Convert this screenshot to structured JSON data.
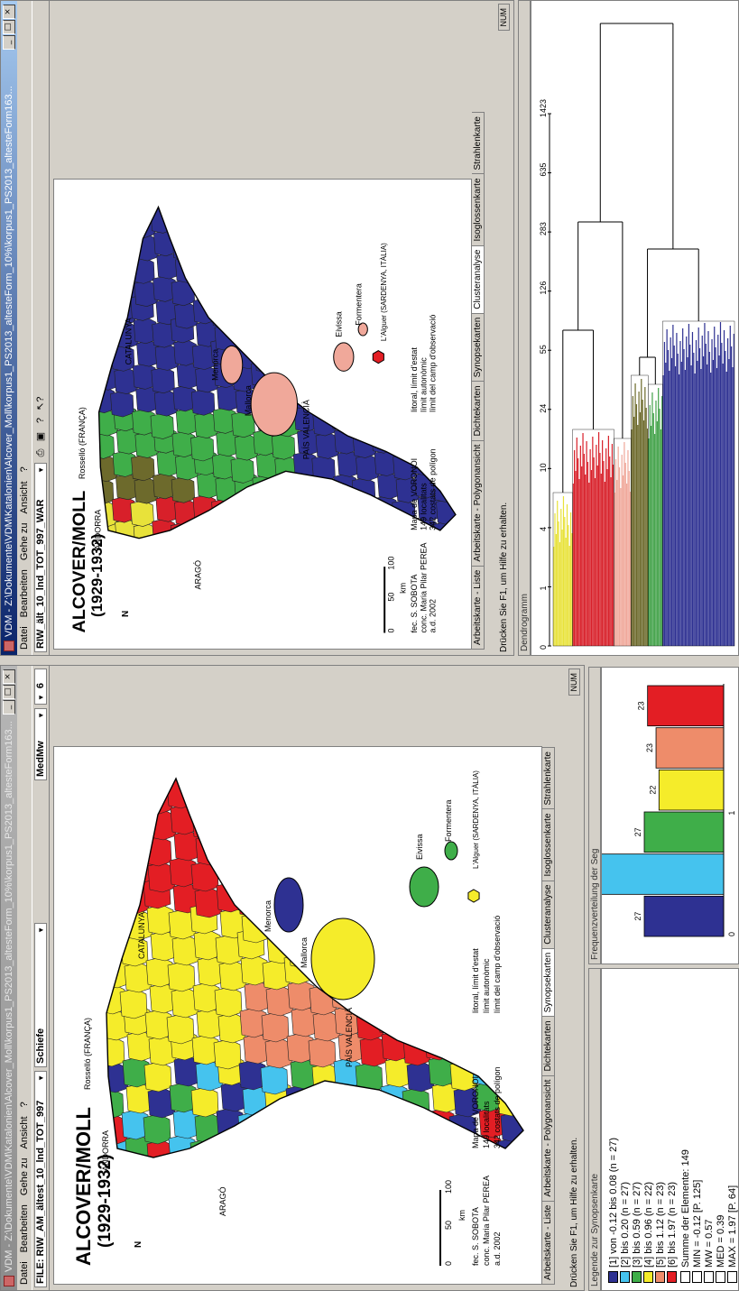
{
  "left_window": {
    "title": "VDM - Z:\\Dokumente\\VDM\\Katalonien\\Alcover_Moll\\korpus1_PS2013_altesteForm_10%\\korpus1_PS2013_altesteForm163...",
    "menu": [
      "Datei",
      "Bearbeiten",
      "Gehe zu",
      "Ansicht",
      "?"
    ],
    "file_label": "FILE: RIW_AM_ältest_10_lnd_TOT_997",
    "mode": "Schiefe",
    "algorithm": "MedMw",
    "classes": "6",
    "tabs": [
      "Arbeitskarte - Liste",
      "Arbeitskarte - Polygonansicht",
      "Dichtekarten",
      "Synopsekarten",
      "Clusteranalyse",
      "Isoglossenkarte",
      "Strahlenkarte"
    ],
    "status": "Drücken Sie F1, um Hilfe zu erhalten.",
    "num": "NUM"
  },
  "right_window": {
    "title": "VDM - Z:\\Dokumente\\VDM\\Katalonien\\Alcover_Moll\\korpus1_PS2013_altesteForm_10%\\korpus1_PS2013_altesteForm163...",
    "menu": [
      "Datei",
      "Bearbeiten",
      "Gehe zu",
      "Ansicht",
      "?"
    ],
    "file_label": "RIW_ält_10_lnd_TOT_997_WAR",
    "tabs": [
      "Arbeitskarte - Liste",
      "Arbeitskarte - Polygonansicht",
      "Dichtekarten",
      "Synopsekarten",
      "Clusteranalyse",
      "Isoglossenkarte",
      "Strahlenkarte"
    ],
    "status": "Drücken Sie F1, um Hilfe zu erhalten.",
    "num": "NUM"
  },
  "map": {
    "title_line1": "ALCOVER/MOLL",
    "title_line2": "(1929-1932)",
    "regions": [
      "ANDORRA",
      "Rosselló (FRANÇA)",
      "CATALUNYA",
      "ARAGÓ",
      "PAÍS VALENCIÀ",
      "Menorca",
      "Mallorca",
      "Eivissa",
      "Formentera",
      "L'Alguer (SARDENYA, ITÀLIA)"
    ],
    "credits": [
      "fec. S. SOBOTA",
      "conc. Maria Pilar PEREA",
      "a.d. 2002"
    ],
    "voronoi": [
      "Mapa de VORONOI",
      "149 localitats",
      "342 costats de polígon"
    ],
    "legend_lines": [
      "litoral, límit d'estat",
      "límit autonòmic",
      "límit del camp d'observació"
    ],
    "scale": [
      "0",
      "50",
      "100",
      "km"
    ],
    "north": "N"
  },
  "synopsis_legend": {
    "caption": "Legende zur Synopsenkarte",
    "classes": [
      {
        "label": "[1] von -0.12 bis 0.08 (n = 27)",
        "color": "#2e3192"
      },
      {
        "label": "[2] bis 0.20 (n = 27)",
        "color": "#45c3ee"
      },
      {
        "label": "[3] bis 0.59 (n = 27)",
        "color": "#3fae49"
      },
      {
        "label": "[4] bis 0.96 (n = 22)",
        "color": "#f5ec2a"
      },
      {
        "label": "[5] bis 1.12 (n = 23)",
        "color": "#ee8c6a"
      },
      {
        "label": "[6] bis 1.97 (n = 23)",
        "color": "#e31e24"
      }
    ],
    "stats": [
      "Summe der Elemente: 149",
      "MIN = -0.12  [P. 125]",
      "MW = 0.57",
      "MED = 0.39",
      "MAX = 1.97  [P. 64]"
    ]
  },
  "histogram": {
    "caption": "Frequenzverteilung der Seg",
    "chart_data": {
      "type": "bar",
      "categories": [
        "1",
        "2",
        "3",
        "4",
        "5",
        "6"
      ],
      "values": [
        27,
        27,
        27,
        22,
        23,
        23
      ],
      "xlim": [
        -0.12,
        1.97
      ],
      "ticks": [
        "0",
        "1"
      ]
    }
  },
  "dendrogram": {
    "caption": "Dendrogramm",
    "chart_data": {
      "type": "dendrogram",
      "axis_ticks": [
        "0",
        "1",
        "4",
        "10",
        "24",
        "55",
        "126",
        "283",
        "635",
        "1423"
      ],
      "clusters": [
        {
          "name": "yellow",
          "color": "#e8e23a",
          "leaves": 16
        },
        {
          "name": "red",
          "color": "#d8202a",
          "leaves": 34
        },
        {
          "name": "pink",
          "color": "#f0a89a",
          "leaves": 14
        },
        {
          "name": "olive",
          "color": "#6d6a2c",
          "leaves": 14
        },
        {
          "name": "green",
          "color": "#43a24a",
          "leaves": 12
        },
        {
          "name": "blue",
          "color": "#2e3192",
          "leaves": 59
        }
      ]
    }
  },
  "icons": [
    "new-icon",
    "open-icon",
    "save-icon",
    "print-icon",
    "help-icon",
    "context-help-icon"
  ]
}
